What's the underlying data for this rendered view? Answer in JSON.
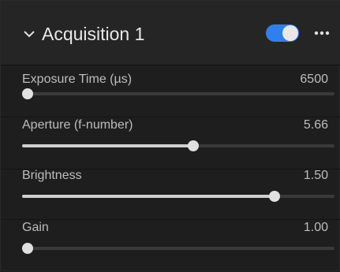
{
  "panel": {
    "title": "Acquisition 1",
    "enabled": true,
    "accent_color": "#2f80ed"
  },
  "icons": {
    "collapse": "chevron-down-icon",
    "more": "more-horizontal-icon"
  },
  "params": [
    {
      "id": "exposure-time",
      "label": "Exposure Time (µs)",
      "value": "6500",
      "fraction": 0.0
    },
    {
      "id": "aperture",
      "label": "Aperture (f-number)",
      "value": "5.66",
      "fraction": 0.55
    },
    {
      "id": "brightness",
      "label": "Brightness",
      "value": "1.50",
      "fraction": 0.82
    },
    {
      "id": "gain",
      "label": "Gain",
      "value": "1.00",
      "fraction": 0.0
    }
  ]
}
